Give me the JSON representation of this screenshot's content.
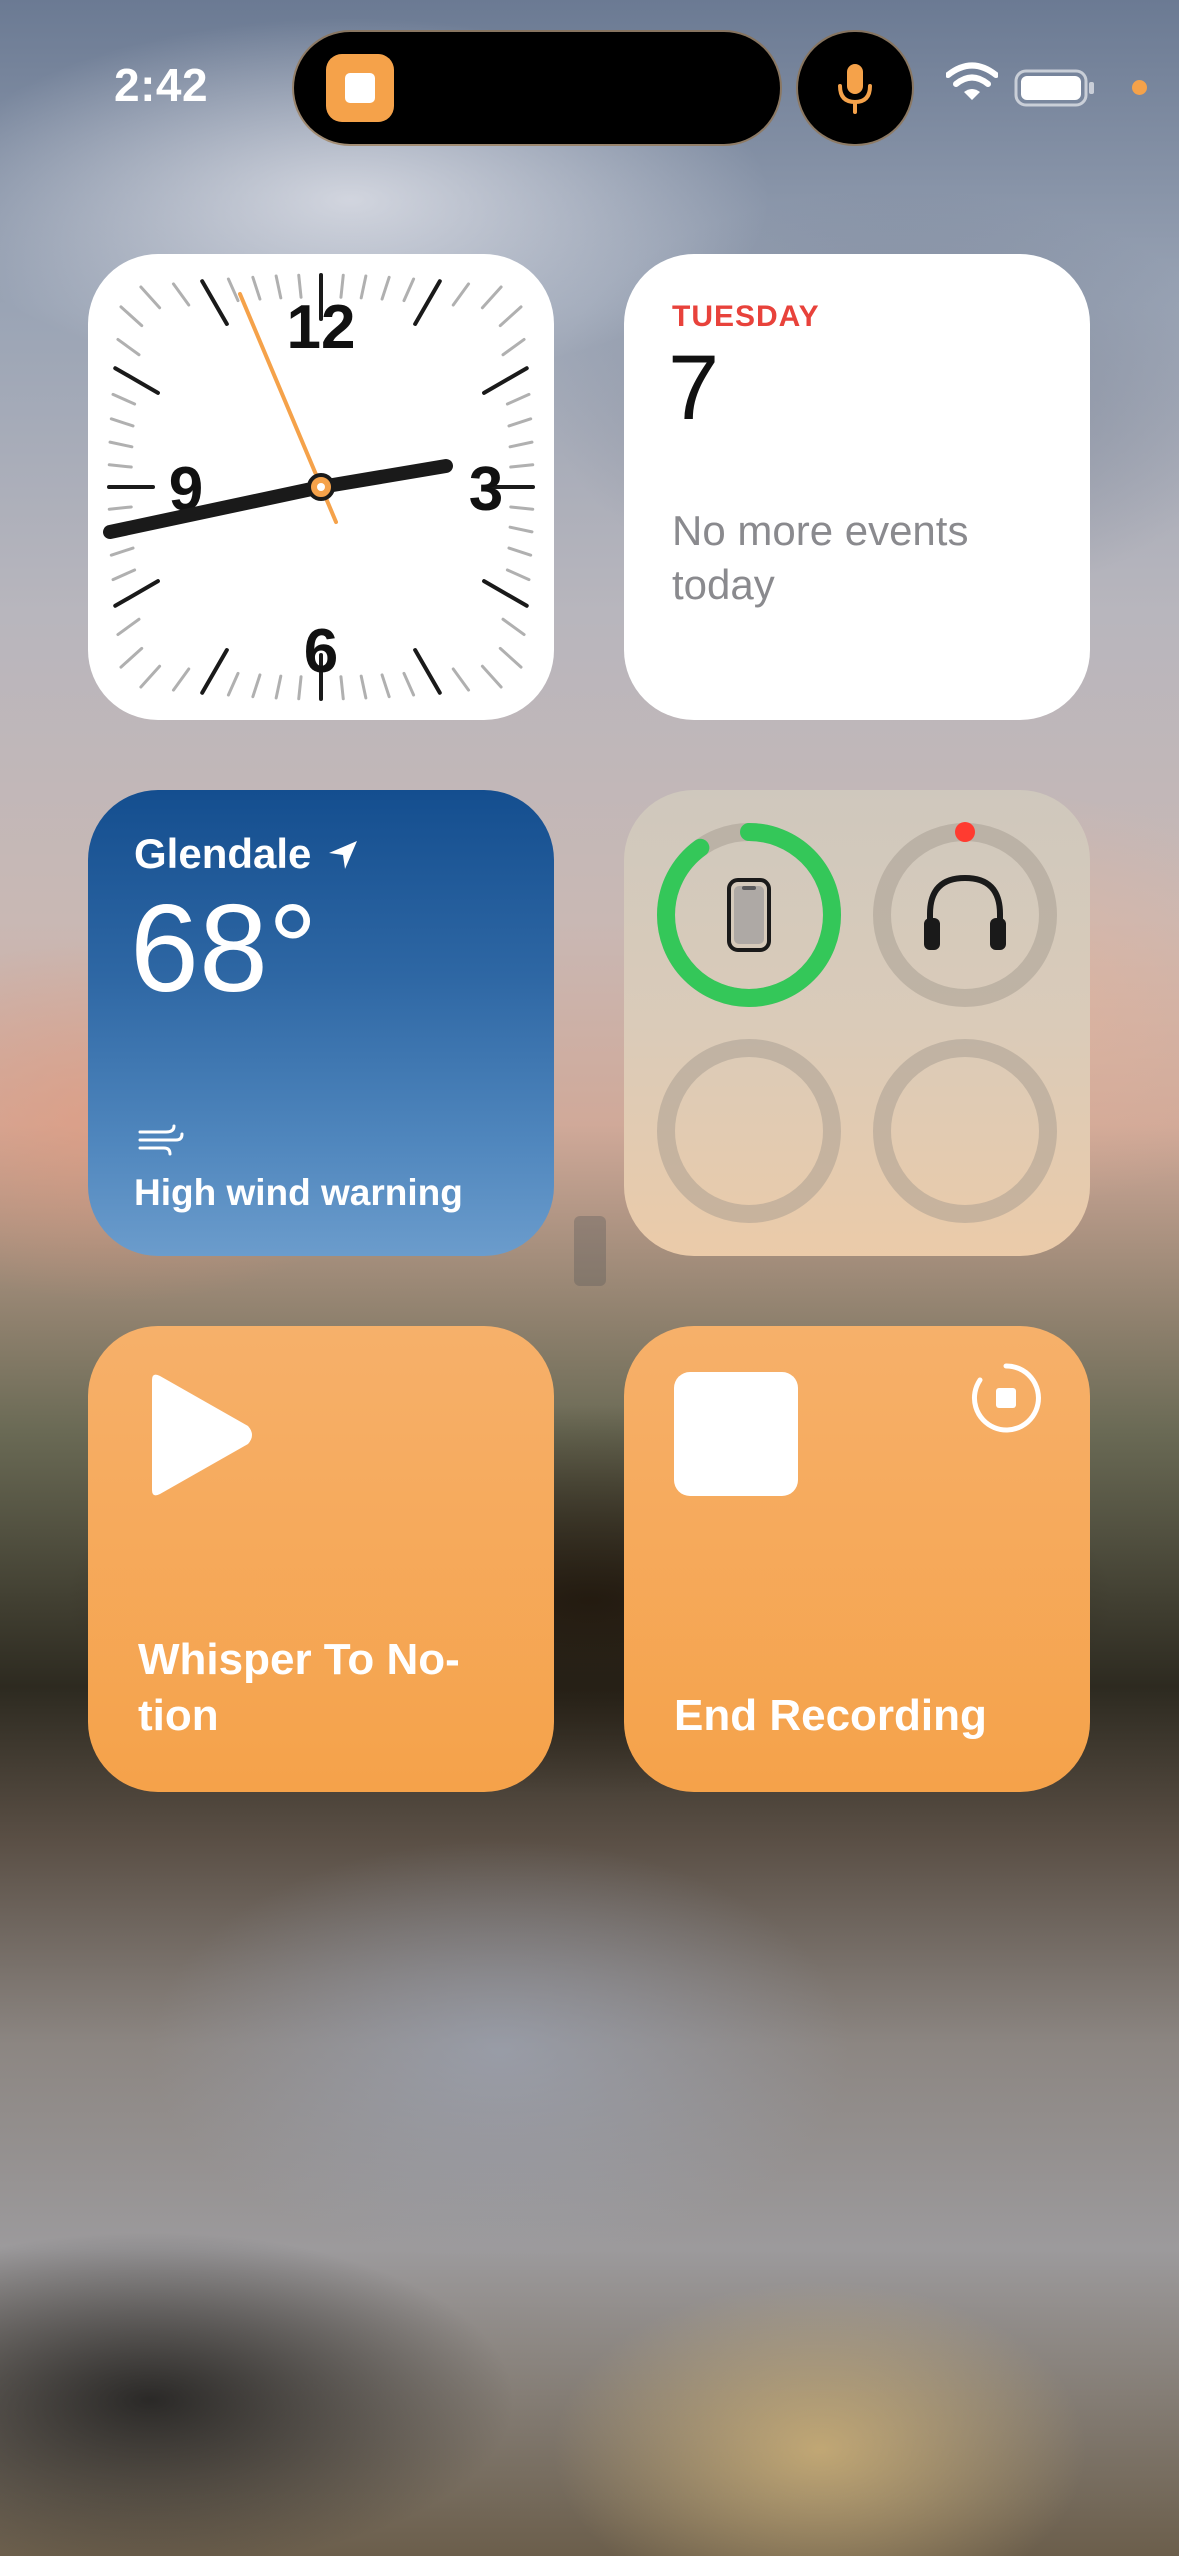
{
  "status_bar": {
    "time": "2:42",
    "recording_app_icon": "stop-square-icon",
    "mic_icon": "microphone-icon",
    "wifi_icon": "wifi-icon",
    "battery_icon": "battery-icon",
    "accent": "#f5a24a"
  },
  "clock_widget": {
    "numerals": [
      "12",
      "3",
      "6",
      "9"
    ],
    "time_shown": "2:42",
    "second_hand_color": "#f5a24a"
  },
  "calendar_widget": {
    "day": "TUESDAY",
    "date": "7",
    "events_text": "No more events today",
    "accent": "#e8423b"
  },
  "weather_widget": {
    "city": "Glendale",
    "temperature": "68°",
    "condition": "High wind warning",
    "location_icon": "location-arrow-icon",
    "wind_icon": "wind-icon"
  },
  "batteries_widget": {
    "devices": [
      {
        "name": "iphone",
        "icon": "iphone-icon",
        "level": 0.9,
        "color": "#34c759"
      },
      {
        "name": "headphones",
        "icon": "headphones-icon",
        "level": null,
        "status_color": "#ff3b30"
      },
      {
        "name": "empty-slot-1",
        "icon": "",
        "level": null
      },
      {
        "name": "empty-slot-2",
        "icon": "",
        "level": null
      }
    ]
  },
  "shortcuts": {
    "whisper": {
      "label": "Whisper To No-\ntion",
      "icon": "play-icon"
    },
    "end_recording": {
      "label": "End Recording",
      "icon": "stop-icon",
      "badge_icon": "recording-progress-icon"
    },
    "color": "#f5a24a"
  }
}
